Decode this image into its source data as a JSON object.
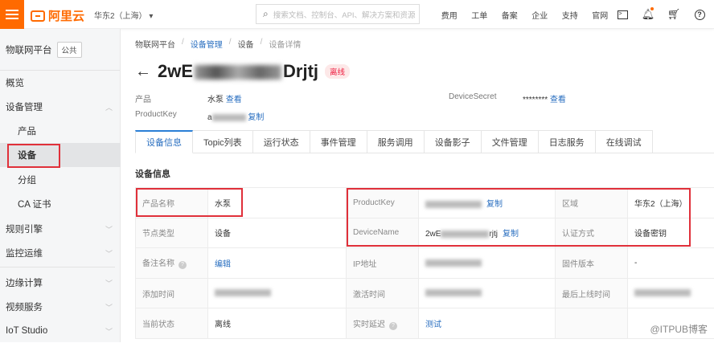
{
  "topbar": {
    "logo": "阿里云",
    "region": "华东2（上海）",
    "search_placeholder": "搜索文档、控制台、API、解决方案和资源",
    "nav": [
      "费用",
      "工单",
      "备案",
      "企业",
      "支持",
      "官网"
    ],
    "icons": [
      "terminal-icon",
      "bell-icon",
      "cart-icon",
      "help-icon"
    ],
    "accent": "#ff6a00"
  },
  "sidebar": {
    "title": "物联网平台",
    "tag": "公共",
    "items": [
      {
        "label": "概览",
        "sub": false,
        "chev": false
      },
      {
        "label": "设备管理",
        "sub": false,
        "chev": "up"
      },
      {
        "label": "产品",
        "sub": true,
        "chev": false
      },
      {
        "label": "设备",
        "sub": true,
        "chev": false,
        "active": true
      },
      {
        "label": "分组",
        "sub": true,
        "chev": false
      },
      {
        "label": "CA 证书",
        "sub": true,
        "chev": false
      },
      {
        "label": "规则引擎",
        "sub": false,
        "chev": "down"
      },
      {
        "label": "监控运维",
        "sub": false,
        "chev": "down"
      },
      {
        "label": "边缘计算",
        "sub": false,
        "chev": "down"
      },
      {
        "label": "视频服务",
        "sub": false,
        "chev": "down"
      },
      {
        "label": "IoT Studio",
        "sub": false,
        "chev": "down"
      }
    ]
  },
  "breadcrumb": [
    "物联网平台",
    "设备管理",
    "设备",
    "设备详情"
  ],
  "device": {
    "name_prefix": "2wE",
    "name_suffix": "Drjtj",
    "status": "离线",
    "product_label": "产品",
    "product_value": "水泵",
    "view": "查看",
    "productkey_label": "ProductKey",
    "copy": "复制",
    "secret_label": "DeviceSecret",
    "secret_value": "********"
  },
  "tabs": [
    "设备信息",
    "Topic列表",
    "运行状态",
    "事件管理",
    "服务调用",
    "设备影子",
    "文件管理",
    "日志服务",
    "在线调试"
  ],
  "section_title": "设备信息",
  "info_table": [
    [
      {
        "k": "产品名称"
      },
      {
        "v": "水泵"
      },
      {
        "k": "ProductKey"
      },
      {
        "blur": true,
        "link": "复制"
      },
      {
        "k": "区域"
      },
      {
        "v": "华东2（上海）"
      }
    ],
    [
      {
        "k": "节点类型"
      },
      {
        "v": "设备"
      },
      {
        "k": "DeviceName"
      },
      {
        "v": "2wE",
        "blur": true,
        "tail": "rjtj",
        "link": "复制"
      },
      {
        "k": "认证方式"
      },
      {
        "v": "设备密钥"
      }
    ],
    [
      {
        "k": "备注名称",
        "help": true
      },
      {
        "link": "编辑"
      },
      {
        "k": "IP地址"
      },
      {
        "blur": true
      },
      {
        "k": "固件版本"
      },
      {
        "v": "-"
      }
    ],
    [
      {
        "k": "添加时间"
      },
      {
        "blur": true
      },
      {
        "k": "激活时间"
      },
      {
        "blur": true
      },
      {
        "k": "最后上线时间"
      },
      {
        "blur": true
      }
    ],
    [
      {
        "k": "当前状态"
      },
      {
        "v": "离线"
      },
      {
        "k": "实时延迟",
        "help": true
      },
      {
        "link": "测试"
      },
      {
        "k": ""
      },
      {
        "v": ""
      }
    ]
  ],
  "watermark": "@ITPUB博客"
}
